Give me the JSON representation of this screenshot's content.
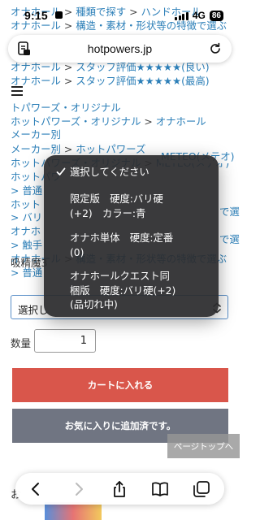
{
  "status_bar": {
    "time": "9:15",
    "network": "4G",
    "battery": "86"
  },
  "url_bar": {
    "host": "hotpowers.jp"
  },
  "breadcrumbs": {
    "lines": [
      {
        "parts": [
          {
            "t": "オナホール",
            "c": "l"
          },
          {
            "t": " > ",
            "c": "s"
          },
          {
            "t": "種類で探す",
            "c": "l"
          },
          {
            "t": " > ",
            "c": "s"
          },
          {
            "t": "ハンドホール",
            "c": "l"
          }
        ]
      },
      {
        "parts": [
          {
            "t": "オナホール",
            "c": "l"
          },
          {
            "t": " > ",
            "c": "s"
          },
          {
            "t": "構造・素材・形状等の特徴で選ぶ",
            "c": "l"
          }
        ]
      },
      {
        "parts": [
          {
            "t": "オナホール",
            "c": "l"
          },
          {
            "t": " > ",
            "c": "s"
          },
          {
            "t": "スタッフ評価★★★★★(良い)",
            "c": "l"
          }
        ]
      },
      {
        "parts": [
          {
            "t": "オナホール",
            "c": "l"
          },
          {
            "t": " > ",
            "c": "s"
          },
          {
            "t": "スタッフ評価★★★★★(最高)",
            "c": "l"
          }
        ]
      },
      {
        "parts": [
          {
            "t": "トパワーズ・オリジナル",
            "c": "l"
          }
        ]
      },
      {
        "parts": [
          {
            "t": "ホットパワーズ・オリジナル",
            "c": "l"
          },
          {
            "t": " > ",
            "c": "s"
          },
          {
            "t": "オナホール",
            "c": "l"
          }
        ]
      },
      {
        "parts": [
          {
            "t": "メーカー別",
            "c": "l"
          }
        ]
      },
      {
        "parts": [
          {
            "t": "メーカー別",
            "c": "l"
          },
          {
            "t": " > ",
            "c": "s"
          },
          {
            "t": "ホットパワーズ",
            "c": "l"
          }
        ]
      },
      {
        "parts": [
          {
            "t": "ホットパワーズ・オリジナル",
            "c": "l"
          },
          {
            "t": " > ",
            "c": "s"
          },
          {
            "t": "METEO(メテオ)",
            "c": "l"
          }
        ]
      },
      {
        "parts": [
          {
            "t": "ホットパワ",
            "c": "l"
          }
        ]
      },
      {
        "parts": [
          {
            "t": "> 普通",
            "c": "l"
          }
        ]
      },
      {
        "parts": [
          {
            "t": "ホット",
            "c": "l"
          }
        ]
      },
      {
        "parts": [
          {
            "t": "> バリ",
            "c": "l"
          }
        ]
      },
      {
        "parts": [
          {
            "t": "オナホ",
            "c": "l"
          }
        ]
      },
      {
        "parts": [
          {
            "t": "> 触手",
            "c": "l"
          }
        ]
      },
      {
        "parts": [
          {
            "t": "オナホール",
            "c": "l"
          },
          {
            "t": " > ",
            "c": "s"
          },
          {
            "t": "構造・素材・形状等の特徴で選ぶ",
            "c": "l"
          }
        ]
      },
      {
        "parts": [
          {
            "t": "> 普通",
            "c": "l"
          }
        ]
      }
    ],
    "right_fragments": [
      {
        "text": "METEO(メテオ)"
      },
      {
        "text": "で選ぶ"
      },
      {
        "text": "で選ぶ"
      }
    ]
  },
  "product": {
    "section_label": "吸精魔3",
    "select_value": "選択し",
    "quantity_label": "数量",
    "quantity_value": "1",
    "add_to_cart": "カートに入れる",
    "added_to_favorites": "お気に入りに追加済です。",
    "page_top": "ページトップへ",
    "favorites_fragment": "お"
  },
  "dropdown": {
    "options": [
      {
        "lines": [
          "選択してください"
        ],
        "selected": true
      },
      {
        "lines": [
          "限定版　硬度:バリ硬",
          "(+2)　カラー:青"
        ],
        "selected": false
      },
      {
        "lines": [
          "オナホ単体　硬度:定番",
          "(0)"
        ],
        "selected": false
      },
      {
        "lines": [
          "オナホールクエスト同",
          "梱版　硬度:バリ硬(+2)",
          "(品切れ中)"
        ],
        "selected": false
      }
    ]
  },
  "icons": {
    "page": "page-menu-icon",
    "reload": "reload-icon",
    "back": "back-icon",
    "forward": "forward-icon",
    "share": "share-icon",
    "bookmarks": "bookmarks-icon",
    "tabs": "tabs-icon",
    "check": "checkmark-icon",
    "hamburger": "hamburger-icon",
    "select_arrow": "chevron-updown-icon"
  },
  "colors": {
    "link": "#2c7fb8",
    "cart": "#d9564b",
    "favorite": "#707582",
    "popup": "#2b2b2d",
    "select_border": "#5a8fc8"
  }
}
